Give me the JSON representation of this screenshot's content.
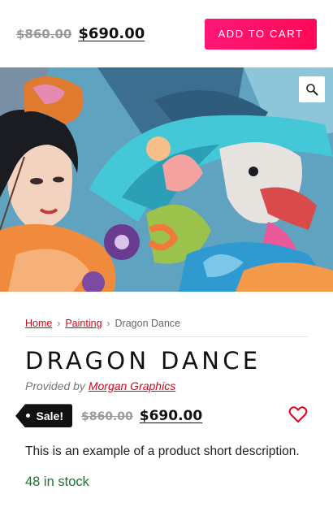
{
  "topbar": {
    "old_price": "$860.00",
    "new_price": "$690.00",
    "add_to_cart_label": "ADD TO CART",
    "accent_color": "#ff1470"
  },
  "gallery": {
    "image_alt": "Dragon Dance artwork",
    "zoom_icon": "magnifier-icon"
  },
  "breadcrumb": {
    "items": [
      {
        "label": "Home",
        "link": true
      },
      {
        "label": "Painting",
        "link": true
      },
      {
        "label": "Dragon Dance",
        "link": false
      }
    ],
    "separator": "›"
  },
  "product": {
    "title": "DRAGON DANCE",
    "provided_prefix": "Provided by",
    "vendor": "Morgan Graphics",
    "sale_badge": "Sale!",
    "old_price": "$860.00",
    "new_price": "$690.00",
    "wishlist_icon": "heart-icon",
    "wishlist_color": "#e0001a",
    "short_description": "This is an example of a product short description.",
    "stock": "48 in stock",
    "stock_color": "#117a2c"
  }
}
